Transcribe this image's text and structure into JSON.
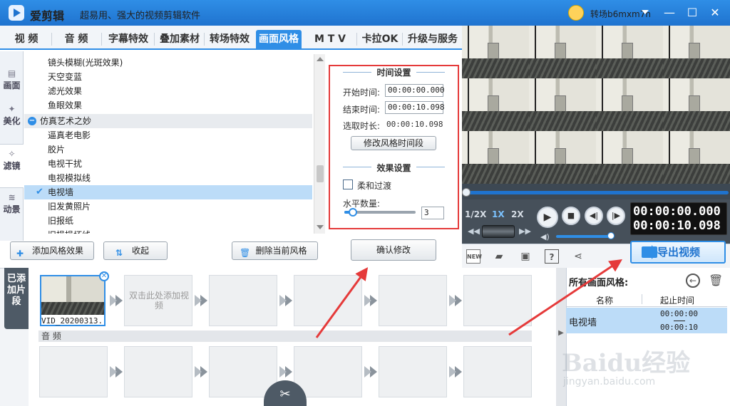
{
  "app": {
    "name": "爱剪辑",
    "tagline": "超易用、强大的视频剪辑软件",
    "user_name": "转场b6mxm7n"
  },
  "window_controls": {
    "minimize": "—",
    "maximize": "☐",
    "close": "✕"
  },
  "menu": {
    "tabs": [
      {
        "label": "视 频"
      },
      {
        "label": "音 频"
      },
      {
        "label": "字幕特效"
      },
      {
        "label": "叠加素材"
      },
      {
        "label": "转场特效"
      },
      {
        "label": "画面风格",
        "active": true
      },
      {
        "label": "M T V"
      },
      {
        "label": "卡拉OK"
      },
      {
        "label": "升级与服务"
      }
    ]
  },
  "side_tabs": [
    {
      "label": "画面",
      "icon": "image-frame-icon"
    },
    {
      "label": "美化",
      "icon": "magic-wand-icon"
    },
    {
      "label": "滤镜",
      "icon": "sparkle-wand-icon",
      "active": true
    },
    {
      "label": "动景",
      "icon": "wave-icon"
    }
  ],
  "effect_list": {
    "items": [
      {
        "label": "镜头模糊(光斑效果)"
      },
      {
        "label": "天空变蓝"
      },
      {
        "label": "滤光效果"
      },
      {
        "label": "鱼眼效果"
      },
      {
        "label": "仿真艺术之妙",
        "group": true
      },
      {
        "label": "逼真老电影"
      },
      {
        "label": "胶片"
      },
      {
        "label": "电视干扰"
      },
      {
        "label": "电视模拟线"
      },
      {
        "label": "电视墙",
        "selected": true
      },
      {
        "label": "旧发黄照片"
      },
      {
        "label": "旧报纸"
      },
      {
        "label": "旧损损坏线"
      }
    ],
    "group_icon": "−",
    "check_icon": "✔"
  },
  "effect_actions": {
    "add": "添加风格效果",
    "collapse": "收起",
    "delete": "删除当前风格"
  },
  "settings": {
    "time_section": "时间设置",
    "start_label": "开始时间:",
    "start_value": "00:00:00.000",
    "end_label": "结束时间:",
    "end_value": "00:00:10.098",
    "duration_label": "选取时长:",
    "duration_value": "00:00:10.098",
    "modify_time_button": "修改风格时间段",
    "effect_section": "效果设置",
    "soft_transition_label": "柔和过渡",
    "soft_transition_checked": false,
    "horizontal_count_label": "水平数量:",
    "horizontal_count_value": "3",
    "confirm_button": "确认修改"
  },
  "player": {
    "speed_half": "1/2X",
    "speed_1x": "1X",
    "speed_2x": "2X",
    "current_time": "00:00:00.000",
    "total_time": "00:00:10.098",
    "progress": 0.0,
    "volume": 0.92
  },
  "toolbar": {
    "new_label": "NEW",
    "export_button": "导出视频"
  },
  "timeline": {
    "section_label": "已添加片段",
    "clip_name": "VID_20200313...",
    "add_video_hint": "双击此处添加视频",
    "audio_label": "音 频"
  },
  "style_panel": {
    "title": "所有画面风格:",
    "col_name": "名称",
    "col_time": "起止时间",
    "rows": [
      {
        "name": "电视墙",
        "start": "00:00:00",
        "end": "00:00:10"
      }
    ]
  },
  "watermark": {
    "text": "Baidu经验",
    "sub": "jingyan.baidu.com"
  },
  "colors": {
    "accent": "#2f8ee6",
    "highlight_box": "#e53a3a"
  }
}
